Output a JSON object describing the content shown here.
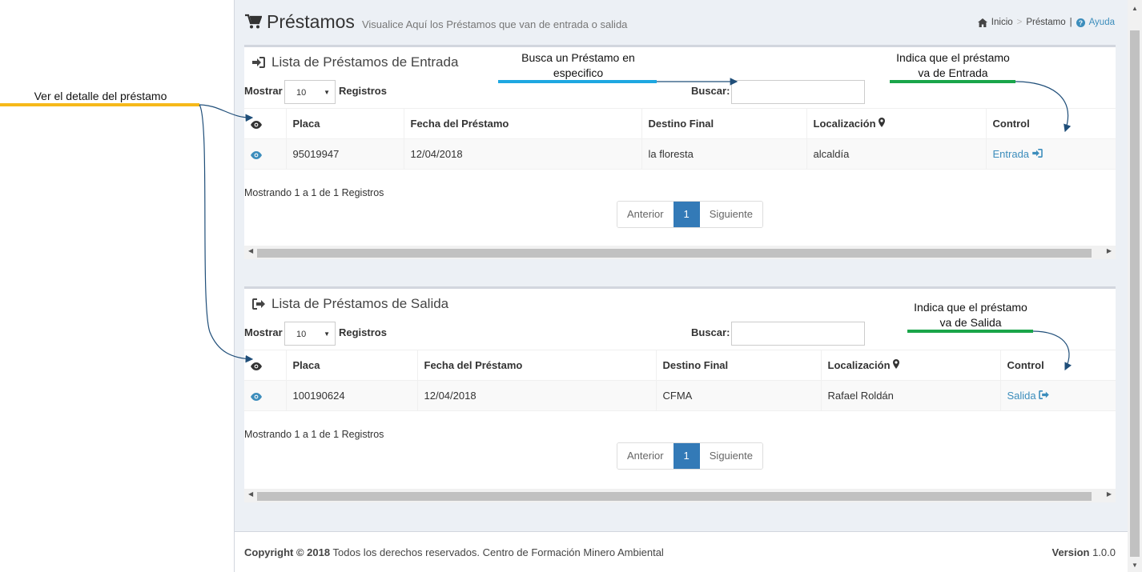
{
  "header": {
    "title": "Préstamos",
    "subtitle": "Visualice Aquí los Préstamos que van de entrada o salida",
    "breadcrumb": {
      "home": "Inicio",
      "sep": ">",
      "current": "Préstamo",
      "pipe": "|",
      "help": "Ayuda"
    }
  },
  "controls": {
    "show_label": "Mostrar",
    "page_size": "10",
    "records_label": "Registros",
    "search_label": "Buscar:"
  },
  "columns": {
    "placa": "Placa",
    "fecha": "Fecha del Préstamo",
    "destino": "Destino Final",
    "localizacion": "Localización",
    "control": "Control"
  },
  "entrada": {
    "title": "Lista de Préstamos de Entrada",
    "row": {
      "placa": "95019947",
      "fecha": "12/04/2018",
      "destino": "la floresta",
      "localizacion": "alcaldía",
      "control": "Entrada"
    },
    "info": "Mostrando 1 a 1 de 1 Registros"
  },
  "salida": {
    "title": "Lista de Préstamos de Salida",
    "row": {
      "placa": "100190624",
      "fecha": "12/04/2018",
      "destino": "CFMA",
      "localizacion": "Rafael Roldán",
      "control": "Salida"
    },
    "info": "Mostrando 1 a 1 de 1 Registros"
  },
  "pager": {
    "prev": "Anterior",
    "page": "1",
    "next": "Siguiente"
  },
  "footer": {
    "copyright_bold": "Copyright © 2018",
    "copyright_text": "Todos los derechos reservados. Centro de Formación Minero Ambiental",
    "version_label": "Version",
    "version": "1.0.0"
  },
  "annotations": {
    "detalle": "Ver el detalle del préstamo",
    "buscar_1": "Busca un Préstamo en",
    "buscar_2": "especifico",
    "entrada_1": "Indica que el préstamo",
    "entrada_2": "va de Entrada",
    "salida_1": "Indica que el préstamo",
    "salida_2": "va de Salida"
  },
  "colors": {
    "link": "#3c8dbc",
    "pager_active": "#337ab7",
    "annot_yellow": "#f6b91a",
    "annot_blue": "#1ea7e1",
    "annot_green": "#1aa54a",
    "arrow": "#1f4e79"
  }
}
